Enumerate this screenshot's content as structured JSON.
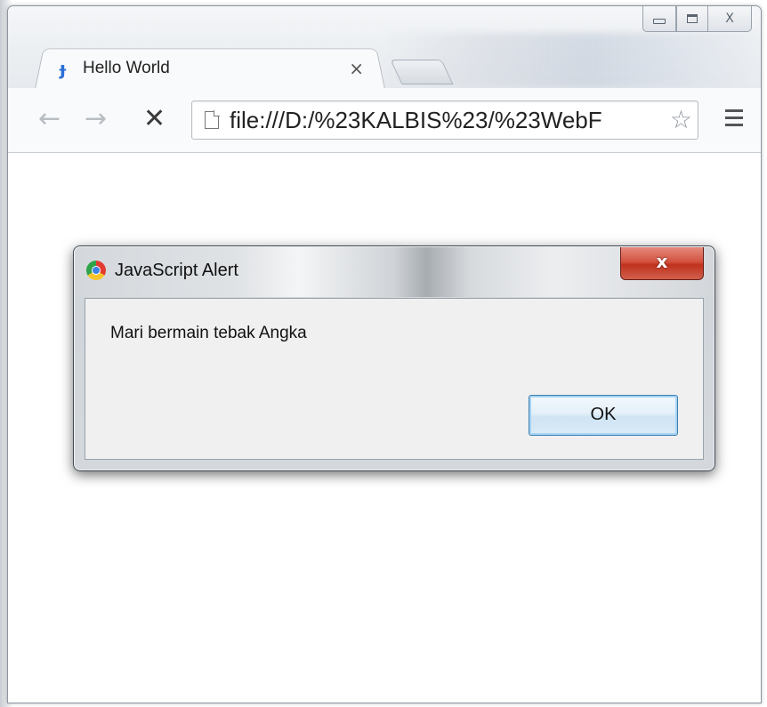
{
  "browser": {
    "tab": {
      "title": "Hello World",
      "close_glyph": "×",
      "favicon": "j-icon"
    },
    "window_controls": {
      "minimize": "minimize-icon",
      "maximize": "maximize-icon",
      "close": "close-icon",
      "close_glyph": "X"
    },
    "toolbar": {
      "back_glyph": "←",
      "forward_glyph": "→",
      "stop_glyph": "✕",
      "url": "file:///D:/%23KALBIS%23/%23WebF",
      "star_glyph": "☆"
    }
  },
  "dialog": {
    "title": "JavaScript Alert",
    "close_glyph": "x",
    "message": "Mari bermain tebak Angka",
    "ok_label": "OK"
  }
}
